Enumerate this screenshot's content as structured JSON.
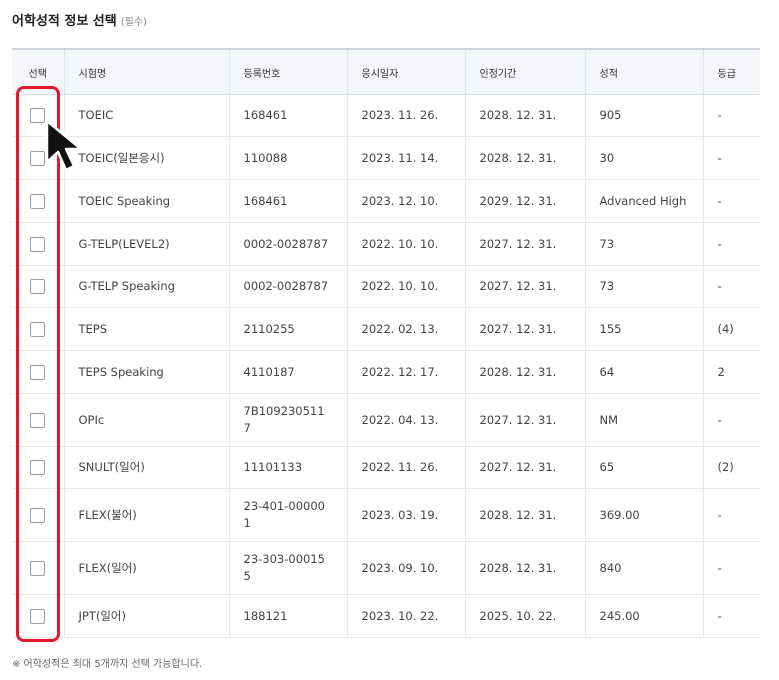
{
  "section": {
    "title": "어학성적 정보 선택",
    "required_note": "(필수)"
  },
  "table": {
    "headers": [
      "선택",
      "시험명",
      "등록번호",
      "응시일자",
      "인정기간",
      "성적",
      "등급"
    ],
    "rows": [
      {
        "exam": "TOEIC",
        "reg_no": "168461",
        "test_date": "2023. 11. 26.",
        "valid_until": "2028. 12. 31.",
        "score": "905",
        "grade": "-"
      },
      {
        "exam": "TOEIC(일본응시)",
        "reg_no": "110088",
        "test_date": "2023. 11. 14.",
        "valid_until": "2028. 12. 31.",
        "score": "30",
        "grade": "-"
      },
      {
        "exam": "TOEIC Speaking",
        "reg_no": "168461",
        "test_date": "2023. 12. 10.",
        "valid_until": "2029. 12. 31.",
        "score": "Advanced High",
        "grade": "-"
      },
      {
        "exam": "G-TELP(LEVEL2)",
        "reg_no": "0002-0028787",
        "test_date": "2022. 10. 10.",
        "valid_until": "2027. 12. 31.",
        "score": "73",
        "grade": "-"
      },
      {
        "exam": "G-TELP Speaking",
        "reg_no": "0002-0028787",
        "test_date": "2022. 10. 10.",
        "valid_until": "2027. 12. 31.",
        "score": "73",
        "grade": "-"
      },
      {
        "exam": "TEPS",
        "reg_no": "2110255",
        "test_date": "2022. 02. 13.",
        "valid_until": "2027. 12. 31.",
        "score": "155",
        "grade": "(4)"
      },
      {
        "exam": "TEPS Speaking",
        "reg_no": "4110187",
        "test_date": "2022. 12. 17.",
        "valid_until": "2028. 12. 31.",
        "score": "64",
        "grade": "2"
      },
      {
        "exam": "OPIc",
        "reg_no": "7B109230511\n7",
        "test_date": "2022. 04. 13.",
        "valid_until": "2027. 12. 31.",
        "score": "NM",
        "grade": "-"
      },
      {
        "exam": "SNULT(일어)",
        "reg_no": "11101133",
        "test_date": "2022. 11. 26.",
        "valid_until": "2027. 12. 31.",
        "score": "65",
        "grade": "(2)"
      },
      {
        "exam": "FLEX(불어)",
        "reg_no": "23-401-00000\n1",
        "test_date": "2023. 03. 19.",
        "valid_until": "2028. 12. 31.",
        "score": "369.00",
        "grade": "-"
      },
      {
        "exam": "FLEX(일어)",
        "reg_no": "23-303-00015\n5",
        "test_date": "2023. 09. 10.",
        "valid_until": "2028. 12. 31.",
        "score": "840",
        "grade": "-"
      },
      {
        "exam": "JPT(일어)",
        "reg_no": "188121",
        "test_date": "2023. 10. 22.",
        "valid_until": "2025. 10. 22.",
        "score": "245.00",
        "grade": "-"
      }
    ]
  },
  "footnote": "※ 어학성적은 최대 5개까지 선택 가능합니다.",
  "colors": {
    "highlight": "#e3192b",
    "header_bg": "#f4f6f9"
  },
  "icons": {
    "cursor": "arrow-cursor-icon"
  }
}
